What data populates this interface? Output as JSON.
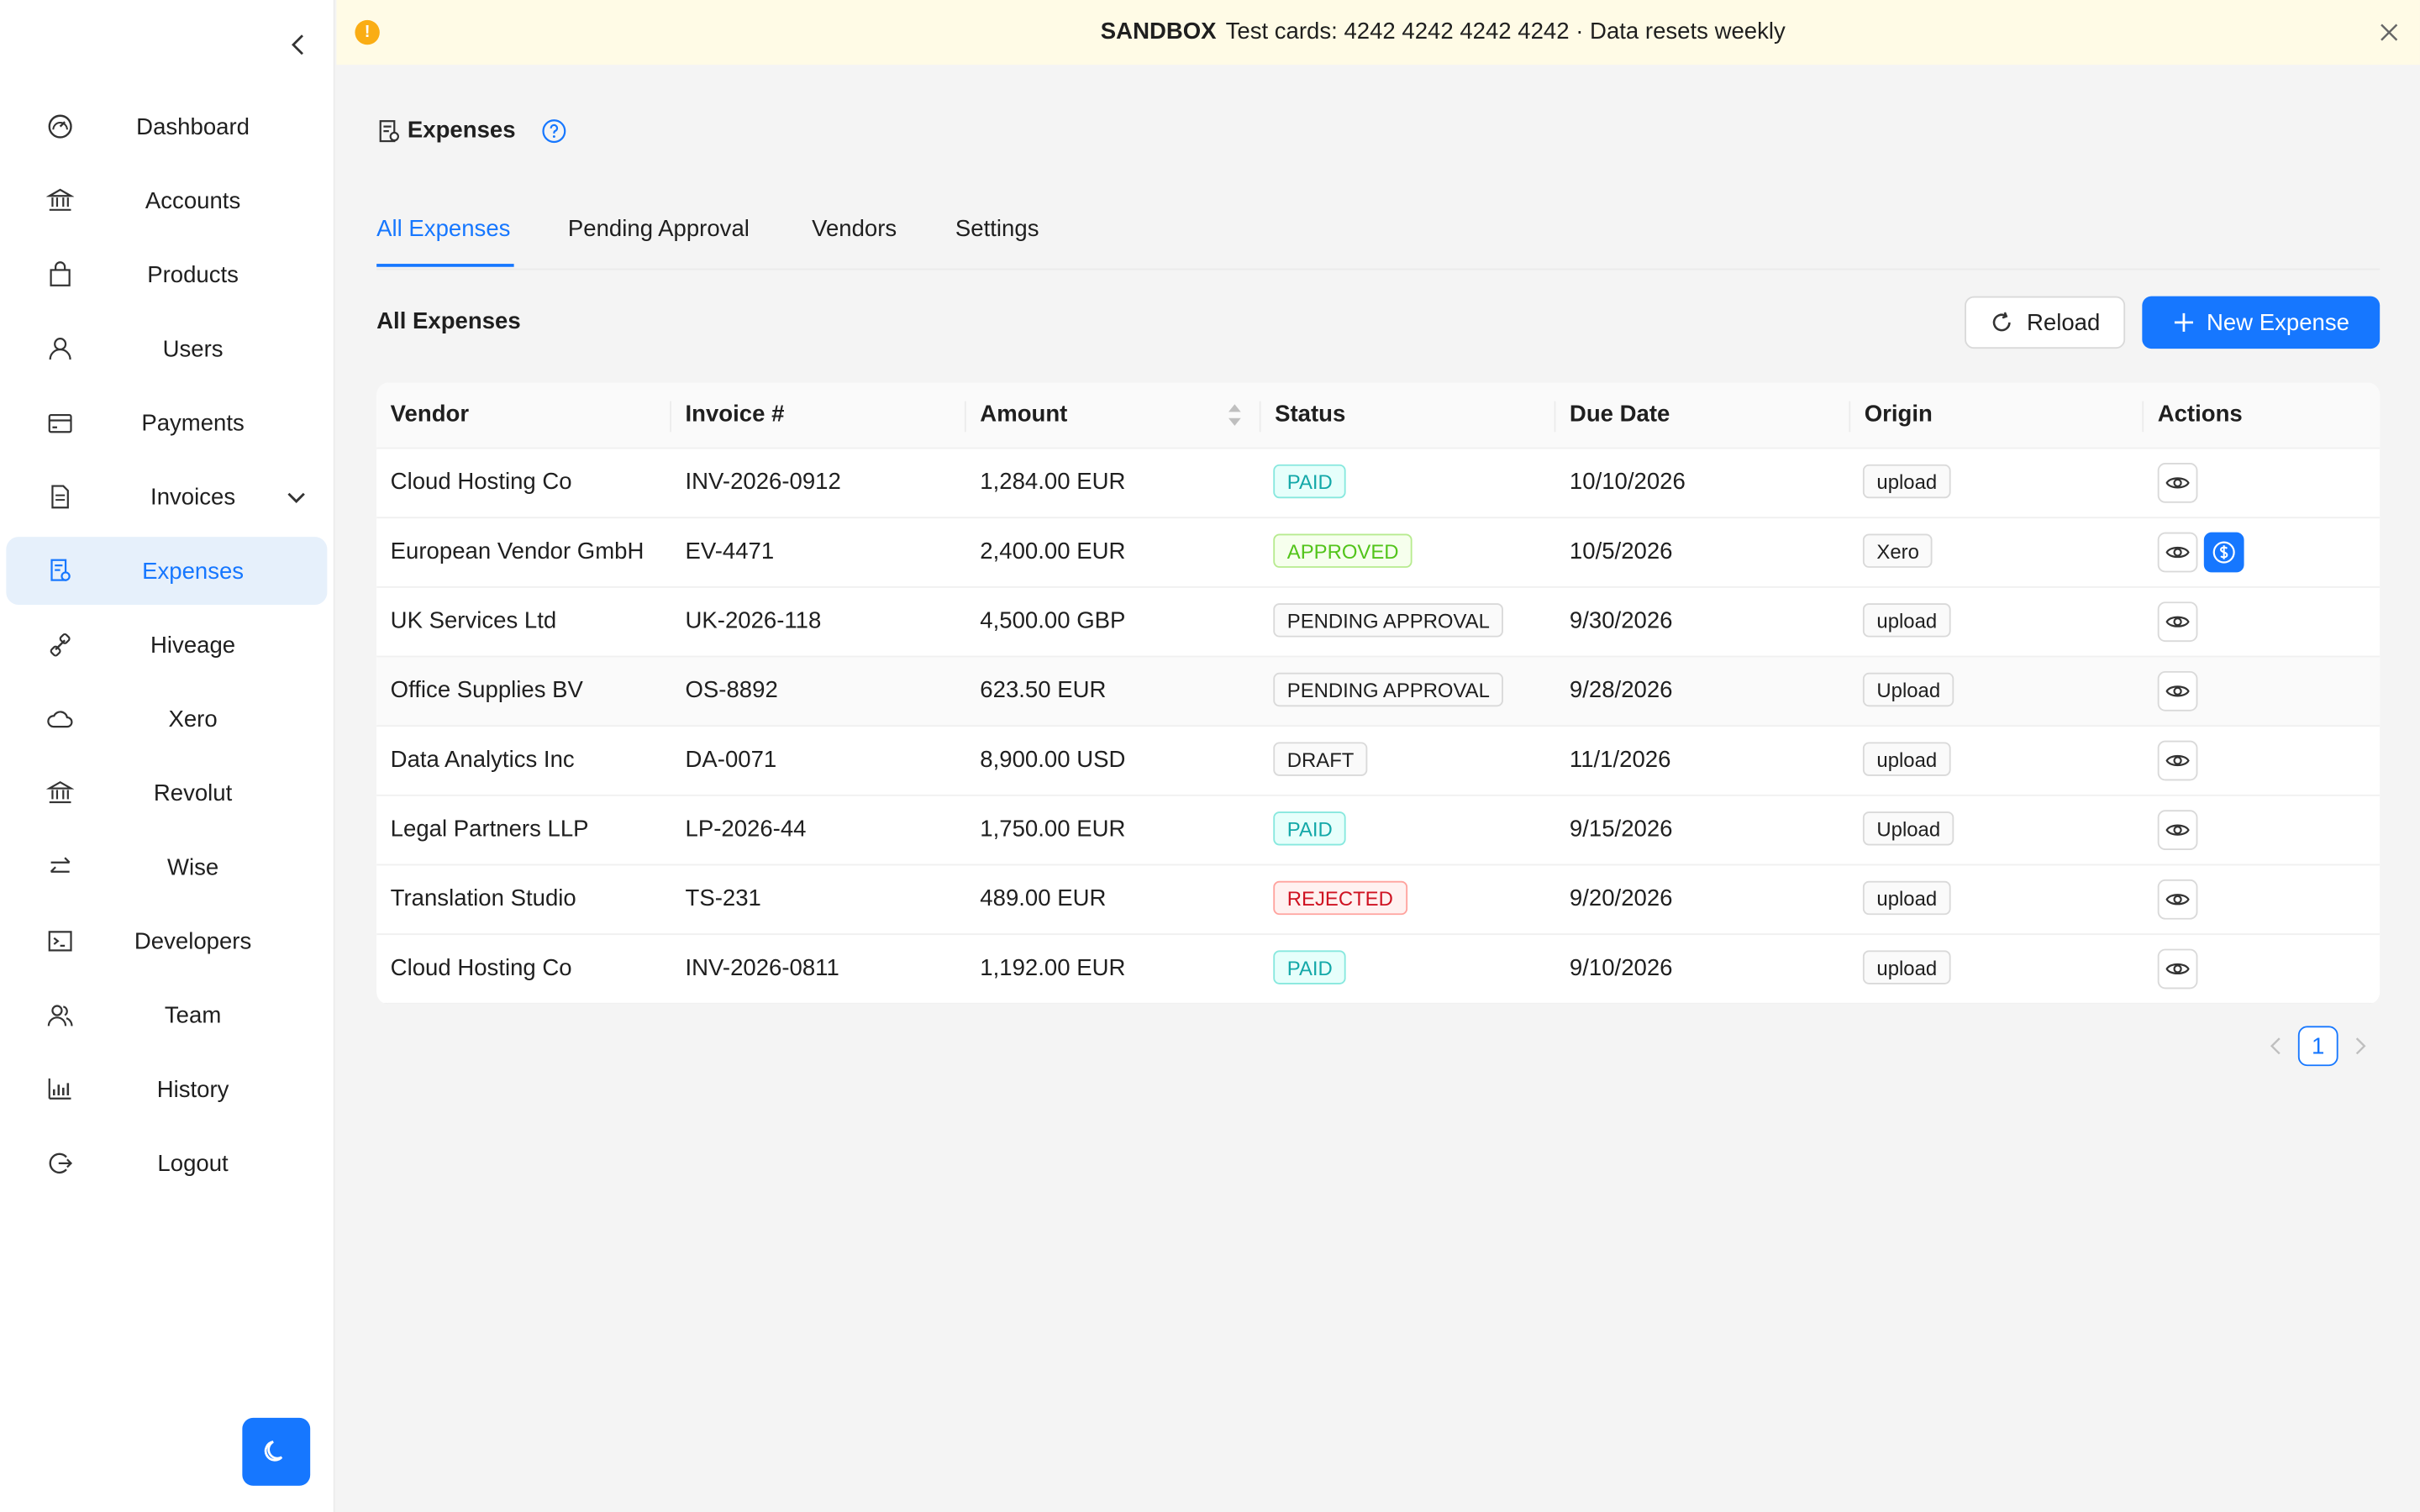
{
  "banner": {
    "badge": "SANDBOX",
    "text": "Test cards: 4242 4242 4242 4242 · Data resets weekly",
    "icon": "warning-icon"
  },
  "sidebar": {
    "items": [
      {
        "label": "Dashboard",
        "icon": "dashboard-icon"
      },
      {
        "label": "Accounts",
        "icon": "bank-icon"
      },
      {
        "label": "Products",
        "icon": "shopping-bag-icon"
      },
      {
        "label": "Users",
        "icon": "user-icon"
      },
      {
        "label": "Payments",
        "icon": "credit-card-icon"
      },
      {
        "label": "Invoices",
        "icon": "document-icon"
      },
      {
        "label": "Expenses",
        "icon": "receipt-icon"
      },
      {
        "label": "Hiveage",
        "icon": "link-icon"
      },
      {
        "label": "Xero",
        "icon": "cloud-icon"
      },
      {
        "label": "Revolut",
        "icon": "bank-icon"
      },
      {
        "label": "Wise",
        "icon": "swap-icon"
      },
      {
        "label": "Developers",
        "icon": "code-icon"
      },
      {
        "label": "Team",
        "icon": "team-icon"
      },
      {
        "label": "History",
        "icon": "bar-chart-icon"
      },
      {
        "label": "Logout",
        "icon": "logout-icon"
      }
    ],
    "active": "Expenses",
    "accent": "#1677ff"
  },
  "page": {
    "title": "Expenses"
  },
  "tabs": [
    "All Expenses",
    "Pending Approval",
    "Vendors",
    "Settings"
  ],
  "section": {
    "title": "All Expenses",
    "reload_label": "Reload",
    "new_label": "New Expense"
  },
  "table": {
    "columns": [
      "Vendor",
      "Invoice #",
      "Amount",
      "Status",
      "Due Date",
      "Origin",
      "Actions"
    ],
    "rows": [
      {
        "vendor": "Cloud Hosting Co",
        "invoice": "INV-2026-0912",
        "amount": "1,284.00 EUR",
        "status": "PAID",
        "due": "10/10/2026",
        "origin": "upload"
      },
      {
        "vendor": "European Vendor GmbH",
        "invoice": "EV-4471",
        "amount": "2,400.00 EUR",
        "status": "APPROVED",
        "due": "10/5/2026",
        "origin": "Xero"
      },
      {
        "vendor": "UK Services Ltd",
        "invoice": "UK-2026-118",
        "amount": "4,500.00 GBP",
        "status": "PENDING APPROVAL",
        "due": "9/30/2026",
        "origin": "upload"
      },
      {
        "vendor": "Office Supplies BV",
        "invoice": "OS-8892",
        "amount": "623.50 EUR",
        "status": "PENDING APPROVAL",
        "due": "9/28/2026",
        "origin": "Upload"
      },
      {
        "vendor": "Data Analytics Inc",
        "invoice": "DA-0071",
        "amount": "8,900.00 USD",
        "status": "DRAFT",
        "due": "11/1/2026",
        "origin": "upload"
      },
      {
        "vendor": "Legal Partners LLP",
        "invoice": "LP-2026-44",
        "amount": "1,750.00 EUR",
        "status": "PAID",
        "due": "9/15/2026",
        "origin": "Upload"
      },
      {
        "vendor": "Translation Studio",
        "invoice": "TS-231",
        "amount": "489.00 EUR",
        "status": "REJECTED",
        "due": "9/20/2026",
        "origin": "upload"
      },
      {
        "vendor": "Cloud Hosting Co",
        "invoice": "INV-2026-0811",
        "amount": "1,192.00 EUR",
        "status": "PAID",
        "due": "9/10/2026",
        "origin": "upload"
      }
    ]
  },
  "pagination": {
    "current": "1"
  }
}
